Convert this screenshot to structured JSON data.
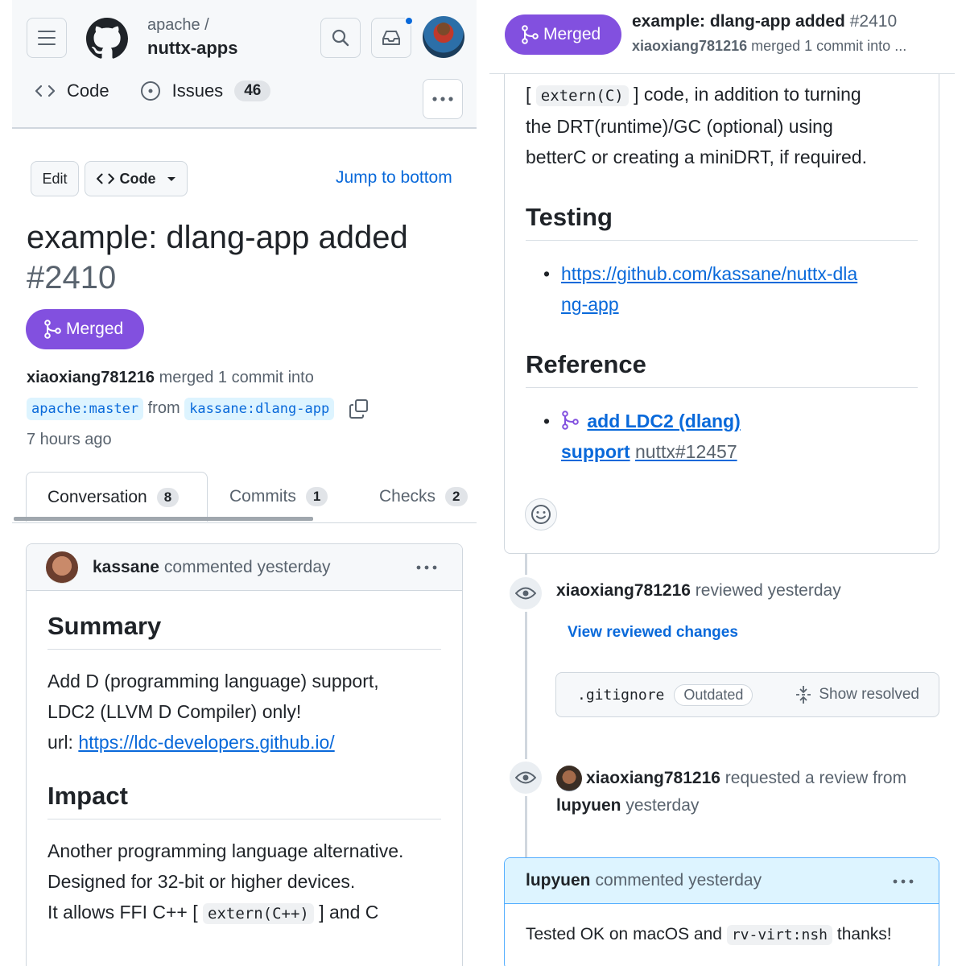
{
  "left": {
    "header": {
      "repo_owner": "apache /",
      "repo_name": "nuttx-apps",
      "tabs": [
        {
          "label": "Code"
        },
        {
          "label": "Issues",
          "count": "46"
        }
      ]
    },
    "actions": {
      "edit_label": "Edit",
      "code_label": "Code",
      "jump_label": "Jump to bottom"
    },
    "pr": {
      "title": "example: dlang-app added",
      "number": "#2410",
      "status": "Merged",
      "merger": "xiaoxiang781216",
      "merge_text": "merged 1 commit into",
      "base_branch": "apache:master",
      "from_text": "from",
      "head_branch": "kassane:dlang-app",
      "time": "7 hours ago"
    },
    "tabs": [
      {
        "label": "Conversation",
        "count": "8"
      },
      {
        "label": "Commits",
        "count": "1"
      },
      {
        "label": "Checks",
        "count": "2"
      }
    ],
    "comment": {
      "author": "kassane",
      "meta": "commented yesterday",
      "summary_heading": "Summary",
      "summary_line1": "Add D (programming language) support,",
      "summary_line2": "LDC2 (LLVM D Compiler) only!",
      "summary_url_label": "url:",
      "summary_url": "https://ldc-developers.github.io/",
      "impact_heading": "Impact",
      "impact_line1": "Another programming language alternative.",
      "impact_line2": "Designed for 32-bit or higher devices.",
      "impact_line3_pre": "It allows FFI C++ [",
      "impact_code": "extern(C++)",
      "impact_line3_post": "] and C"
    }
  },
  "right": {
    "sticky": {
      "status": "Merged",
      "title": "example: dlang-app added",
      "number": "#2410",
      "merger": "xiaoxiang781216",
      "sub_text": "merged 1 commit into ..."
    },
    "body": {
      "line1_pre": "[",
      "line1_code": "extern(C)",
      "line1_post": "] code, in addition to turning",
      "line2": "the DRT(runtime)/GC (optional) using",
      "line3": "betterC or creating a miniDRT, if required.",
      "testing_heading": "Testing",
      "testing_link": "https://github.com/kassane/nuttx-dlang-app",
      "reference_heading": "Reference",
      "ref_link": "add LDC2 (dlang) support",
      "ref_num": "nuttx#12457"
    },
    "timeline": {
      "review_user": "xiaoxiang781216",
      "review_text": "reviewed yesterday",
      "view_changes": "View reviewed changes",
      "file_name": ".gitignore",
      "outdated": "Outdated",
      "show_resolved": "Show resolved",
      "request_user": "xiaoxiang781216",
      "request_text": "requested a review from",
      "request_target": "lupyuen",
      "request_time": "yesterday"
    },
    "comment2": {
      "author": "lupyuen",
      "meta": "commented yesterday",
      "text_pre": "Tested OK on macOS and",
      "code": "rv-virt:nsh",
      "text_post": "thanks!"
    }
  },
  "colors": {
    "merged": "#8250df",
    "link": "#0969da",
    "muted": "#59636e",
    "border": "#d0d7de",
    "highlight_header": "#ddf4ff"
  },
  "icons": [
    "hamburger-icon",
    "github-logo-icon",
    "search-icon",
    "inbox-icon",
    "code-icon",
    "issue-icon",
    "kebab-icon",
    "caret-down-icon",
    "merge-icon",
    "copy-icon",
    "smiley-icon",
    "eye-icon",
    "unfold-icon"
  ]
}
